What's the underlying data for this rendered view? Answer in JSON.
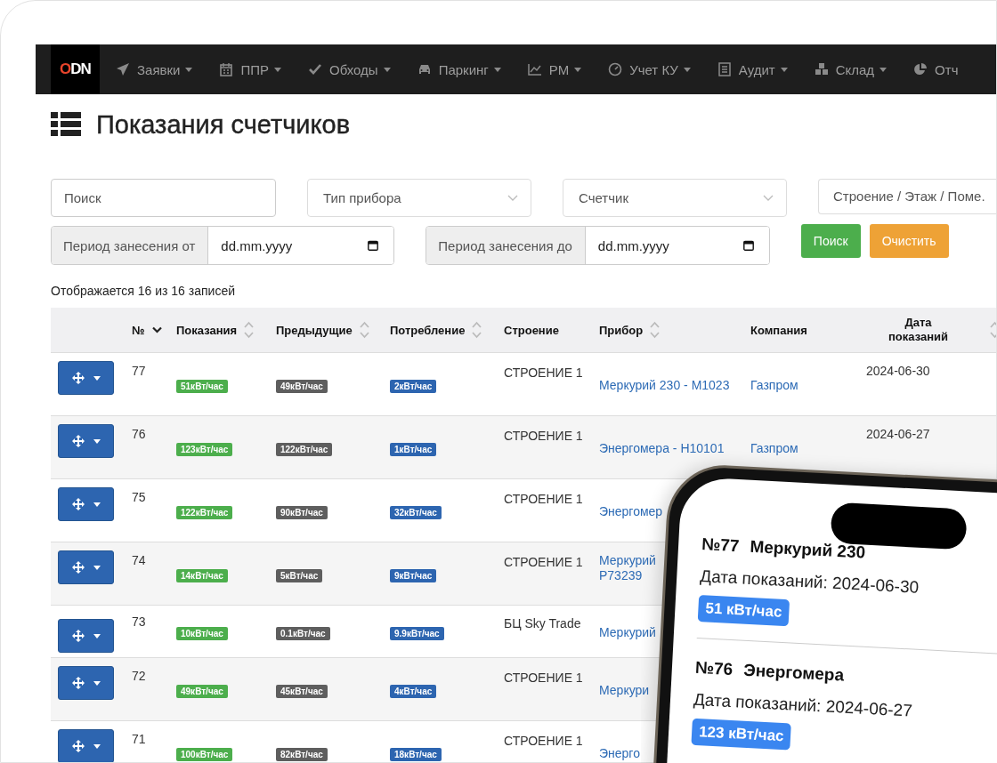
{
  "navbar": {
    "logo": "ODN",
    "items": [
      {
        "label": "Заявки"
      },
      {
        "label": "ППР"
      },
      {
        "label": "Обходы"
      },
      {
        "label": "Паркинг"
      },
      {
        "label": "РМ"
      },
      {
        "label": "Учет КУ"
      },
      {
        "label": "Аудит"
      },
      {
        "label": "Склад"
      },
      {
        "label": "Отч"
      }
    ]
  },
  "page_title": "Показания счетчиков",
  "filters": {
    "search": {
      "placeholder": "Поиск"
    },
    "device_type": {
      "placeholder": "Тип прибора"
    },
    "meter": {
      "placeholder": "Счетчик"
    },
    "location": {
      "placeholder": "Строение / Этаж / Поме."
    },
    "date_from": {
      "label": "Период занесения от",
      "placeholder": "dd.mm.yyyy"
    },
    "date_to": {
      "label": "Период занесения до",
      "placeholder": "dd.mm.yyyy"
    },
    "buttons": [
      {
        "label": "Поиск",
        "kind": "success"
      },
      {
        "label": "Очистить",
        "kind": "warning"
      }
    ]
  },
  "record_count": "Отображается 16 из 16 записей",
  "table": {
    "columns": [
      {
        "sortable": false
      },
      {
        "label": "№",
        "sortable": true,
        "sorted": true
      },
      {
        "label": "Показания",
        "sortable": true,
        "sorted": false
      },
      {
        "label": "Предыдущие",
        "sortable": true,
        "sorted": false
      },
      {
        "label": "Потребление",
        "sortable": true,
        "sorted": false
      },
      {
        "label": "Строение",
        "sortable": false
      },
      {
        "label": "Прибор",
        "sortable": true,
        "sorted": false
      },
      {
        "label": "Компания",
        "sortable": false
      },
      {
        "label": "Дата показаний",
        "sortable": false
      },
      {
        "sortable": true,
        "sorted": false
      }
    ],
    "rows": [
      {
        "number": "77",
        "reading": "51кВт/час",
        "previous": "49кВт/час",
        "consumption": "2кВт/час",
        "building": "СТРОЕНИЕ 1",
        "device": "Меркурий 230 - M1023",
        "company": "Газпром",
        "date": "2024-06-30"
      },
      {
        "number": "76",
        "reading": "123кВт/час",
        "previous": "122кВт/час",
        "consumption": "1кВт/час",
        "building": "СТРОЕНИЕ 1",
        "device": "Энергомера - H10101",
        "company": "Газпром",
        "date": "2024-06-27"
      },
      {
        "number": "75",
        "reading": "122кВт/час",
        "previous": "90кВт/час",
        "consumption": "32кВт/час",
        "building": "СТРОЕНИЕ 1",
        "device": "Энергомер"
      },
      {
        "number": "74",
        "reading": "14кВт/час",
        "previous": "5кВт/час",
        "consumption": "9кВт/час",
        "building": "СТРОЕНИЕ 1",
        "device": "Меркурий\nP73239"
      },
      {
        "number": "73",
        "reading": "10кВт/час",
        "previous": "0.1кВт/час",
        "consumption": "9.9кВт/час",
        "building": "БЦ Sky Trade",
        "device": "Меркурий"
      },
      {
        "number": "72",
        "reading": "49кВт/час",
        "previous": "45кВт/час",
        "consumption": "4кВт/час",
        "building": "СТРОЕНИЕ 1",
        "device": "Меркури"
      },
      {
        "number": "71",
        "reading": "100кВт/час",
        "previous": "82кВт/час",
        "consumption": "18кВт/час",
        "building": "СТРОЕНИЕ 1",
        "device": "Энерго"
      }
    ]
  },
  "phone": {
    "cards": [
      {
        "number": "№77",
        "name": "Меркурий 230",
        "date": "Дата показаний: 2024-06-30",
        "value": "51 кВт/час"
      },
      {
        "number": "№76",
        "name": "Энергомера",
        "date": "Дата показаний: 2024-06-27",
        "value": "123 кВт/час"
      }
    ]
  }
}
